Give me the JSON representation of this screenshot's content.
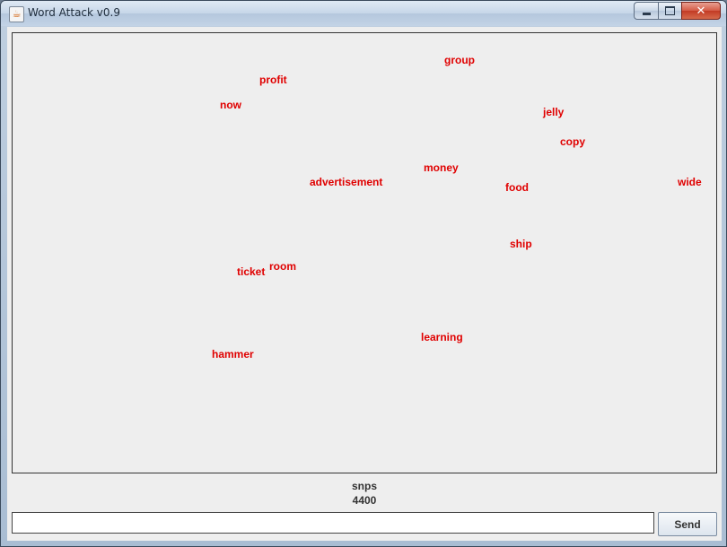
{
  "window": {
    "title": "Word Attack v0.9",
    "app_icon": "java-cup-icon",
    "controls": {
      "minimize": "minimize-icon",
      "maximize": "maximize-icon",
      "close": "close-icon"
    }
  },
  "colors": {
    "word": "#e00000",
    "background": "#eeeeee"
  },
  "game": {
    "words": {
      "group": "group",
      "profit": "profit",
      "now": "now",
      "jelly": "jelly",
      "copy": "copy",
      "money": "money",
      "advertisement": "advertisement",
      "food": "food",
      "wide": "wide",
      "ship": "ship",
      "room": "room",
      "ticket": "ticket",
      "learning": "learning",
      "hammer": "hammer"
    }
  },
  "status": {
    "label": "snps",
    "score": "4400"
  },
  "input": {
    "value": "",
    "placeholder": ""
  },
  "send": {
    "label": "Send"
  }
}
